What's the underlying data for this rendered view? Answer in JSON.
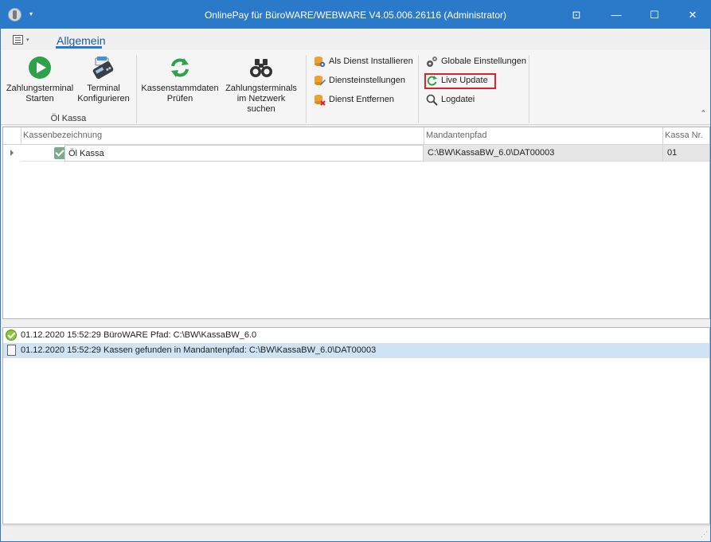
{
  "window": {
    "title": "OnlinePay für BüroWARE/WEBWARE V4.05.006.26116  (Administrator)",
    "controls": {
      "ribbon_options": "⊡",
      "minimize": "—",
      "maximize": "☐",
      "close": "✕"
    },
    "menu_caret": "▾"
  },
  "ribbon": {
    "tabs": [
      {
        "label": "Allgemein",
        "active": true
      }
    ],
    "qat_caret": "▾",
    "groups": [
      {
        "label": "Öl Kassa",
        "buttons": [
          {
            "label_line1": "Zahlungsterminal",
            "label_line2": "Starten",
            "icon": "play-icon"
          },
          {
            "label_line1": "Terminal",
            "label_line2": "Konfigurieren",
            "icon": "card-terminal-icon"
          }
        ]
      },
      {
        "label": "",
        "buttons": [
          {
            "label_line1": "Kassenstammdaten",
            "label_line2": "Prüfen",
            "icon": "refresh-icon"
          },
          {
            "label_line1": "Zahlungsterminals",
            "label_line2": "im Netzwerk suchen",
            "icon": "binoculars-icon"
          }
        ]
      }
    ],
    "service_buttons": [
      {
        "label": "Als Dienst Installieren",
        "icon": "db-gear-icon"
      },
      {
        "label": "Diensteinstellungen",
        "icon": "db-edit-icon"
      },
      {
        "label": "Dienst Entfernen",
        "icon": "db-remove-icon"
      }
    ],
    "settings_buttons": [
      {
        "label": "Globale Einstellungen",
        "icon": "gears-icon"
      },
      {
        "label": "Live Update",
        "icon": "refresh-small-icon",
        "highlighted": true
      },
      {
        "label": "Logdatei",
        "icon": "magnifier-icon"
      }
    ],
    "collapse_caret": "⌃"
  },
  "grid": {
    "columns": [
      "Kassenbezeichnung",
      "Mandantenpfad",
      "Kassa Nr."
    ],
    "rows": [
      {
        "checked": true,
        "name": "Öl Kassa",
        "path": "C:\\BW\\KassaBW_6.0\\DAT00003",
        "nr": "01"
      }
    ]
  },
  "log": {
    "entries": [
      {
        "icon": "success-icon",
        "text": "01.12.2020 15:52:29 BüroWARE Pfad: C:\\BW\\KassaBW_6.0",
        "selected": false
      },
      {
        "icon": "document-icon",
        "text": "01.12.2020 15:52:29 Kassen gefunden in Mandantenpfad: C:\\BW\\KassaBW_6.0\\DAT00003",
        "selected": true
      }
    ]
  },
  "statusbar": {
    "grip": "⋰"
  },
  "colors": {
    "titlebar": "#2b79c9",
    "accent_green": "#2fa14a",
    "highlight_red": "#e0202a",
    "selection": "#cfe3f5"
  }
}
